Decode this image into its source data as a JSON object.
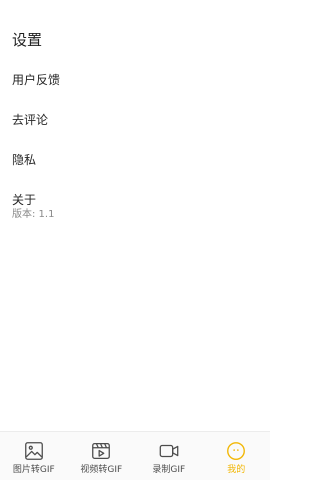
{
  "header": {
    "title": "设置"
  },
  "menu": {
    "feedback": "用户反馈",
    "review": "去评论",
    "privacy": "隐私",
    "about": "关于",
    "version": "版本: 1.1"
  },
  "tabbar": {
    "tabs": [
      {
        "label": "图片转GIF",
        "icon": "image-icon"
      },
      {
        "label": "视频转GIF",
        "icon": "video-clapper-icon"
      },
      {
        "label": "录制GIF",
        "icon": "camera-record-icon"
      },
      {
        "label": "我的",
        "icon": "smiley-icon"
      }
    ],
    "active_index": 3,
    "active_color": "#F2B705",
    "inactive_color": "#4D4D4D"
  }
}
